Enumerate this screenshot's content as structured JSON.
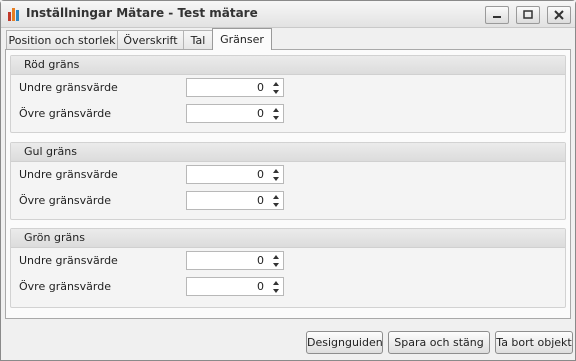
{
  "window": {
    "title": "Inställningar Mätare - Test mätare",
    "icon": "chart-bars-icon"
  },
  "title_buttons": {
    "minimize": "minimize-icon",
    "maximize": "maximize-icon",
    "close": "close-icon"
  },
  "tabs": [
    {
      "label": "Position och storlek",
      "active": false
    },
    {
      "label": "Överskrift",
      "active": false
    },
    {
      "label": "Tal",
      "active": false
    },
    {
      "label": "Gränser",
      "active": true
    }
  ],
  "groups": [
    {
      "title": "Röd gräns",
      "rows": [
        {
          "label": "Undre gränsvärde",
          "value": "0"
        },
        {
          "label": "Övre gränsvärde",
          "value": "0"
        }
      ]
    },
    {
      "title": "Gul gräns",
      "rows": [
        {
          "label": "Undre gränsvärde",
          "value": "0"
        },
        {
          "label": "Övre gränsvärde",
          "value": "0"
        }
      ]
    },
    {
      "title": "Grön gräns",
      "rows": [
        {
          "label": "Undre gränsvärde",
          "value": "0"
        },
        {
          "label": "Övre gränsvärde",
          "value": "0"
        }
      ]
    }
  ],
  "footer": {
    "design_guide": "Designguiden",
    "save_close": "Spara och stäng",
    "delete_object": "Ta bort objekt"
  }
}
